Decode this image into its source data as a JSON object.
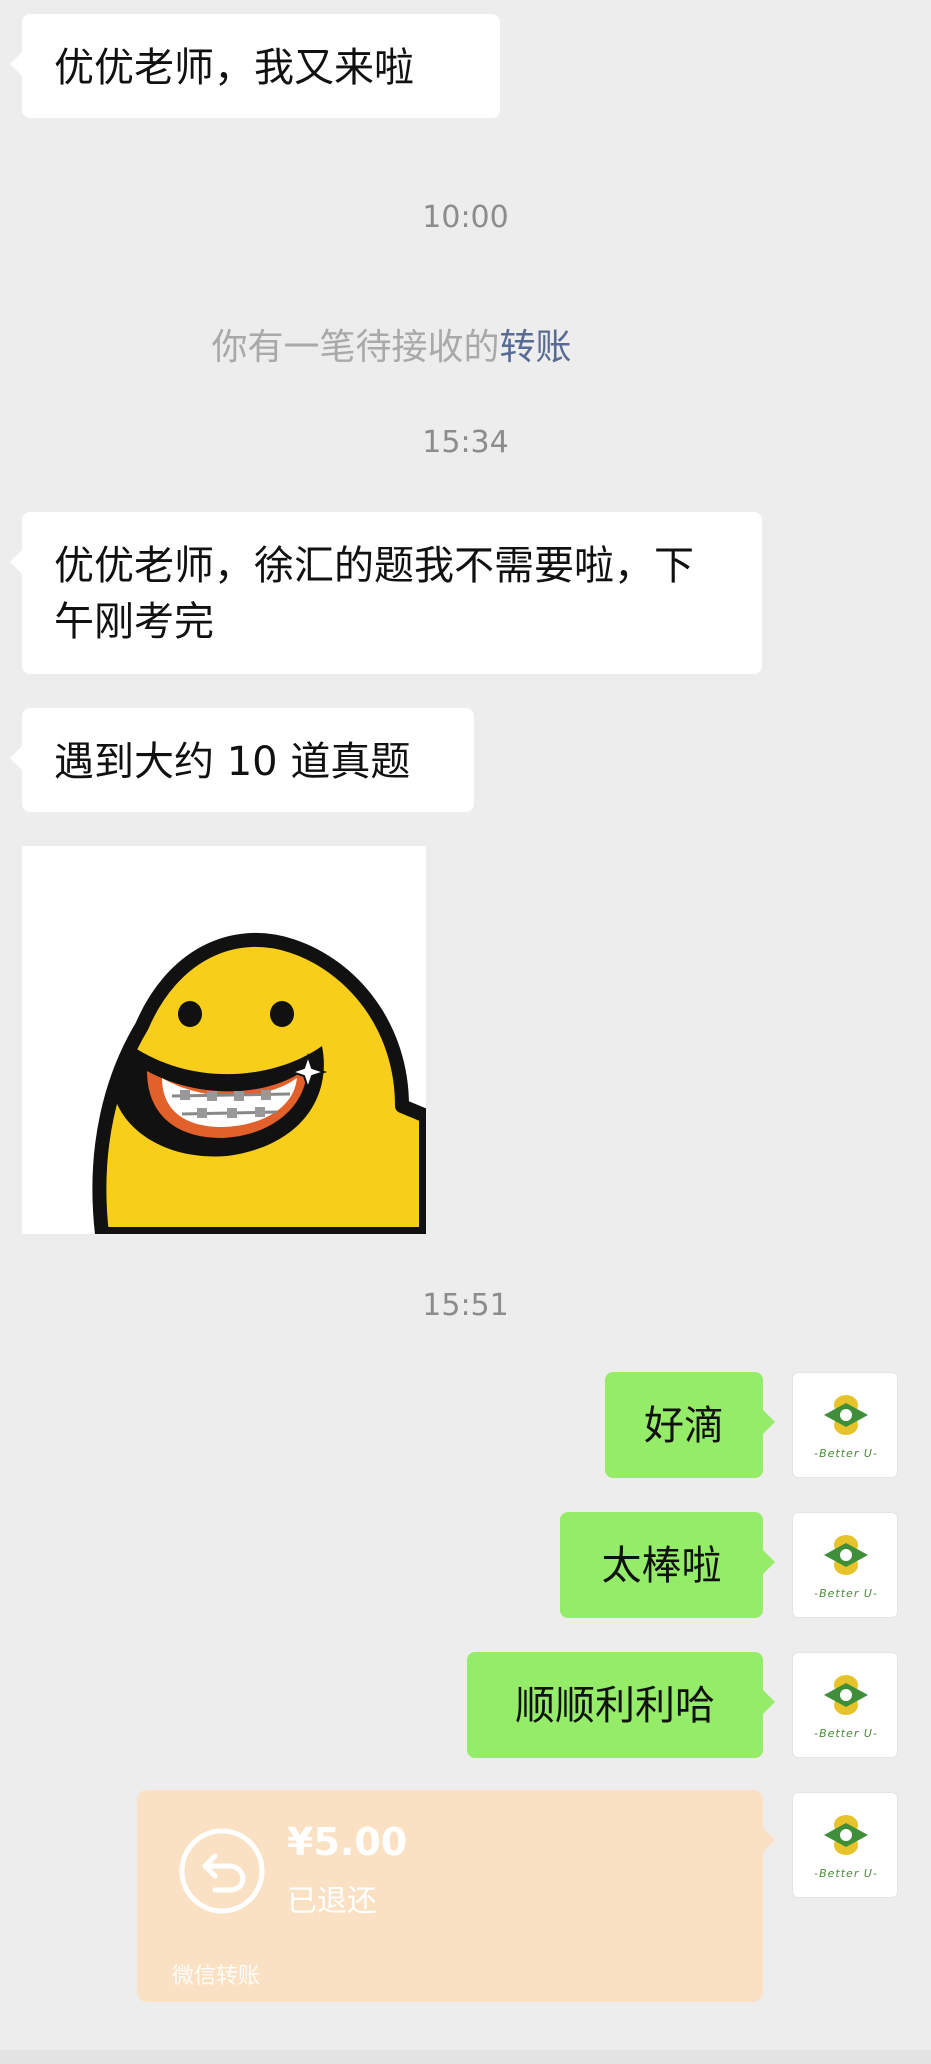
{
  "messages": {
    "m1": "优优老师，我又来啦",
    "m2": "优优老师，徐汇的题我不需要啦，下午刚考完",
    "m3": "遇到大约 10 道真题",
    "r1": "好滴",
    "r2": "太棒啦",
    "r3": "顺顺利利哈"
  },
  "timestamps": {
    "t1": "10:00",
    "t2": "15:34",
    "t3": "15:51"
  },
  "system": {
    "pending_prefix": "你有一笔待接收的",
    "pending_link": "转账"
  },
  "avatar": {
    "text": "-Better U-"
  },
  "transfer": {
    "amount": "¥5.00",
    "status": "已退还",
    "footer": "微信转账"
  },
  "colors": {
    "background": "#ededed",
    "incoming_bubble": "#ffffff",
    "outgoing_bubble": "#95ec69",
    "transfer_card": "#fbe1c4",
    "link": "#576b95"
  }
}
